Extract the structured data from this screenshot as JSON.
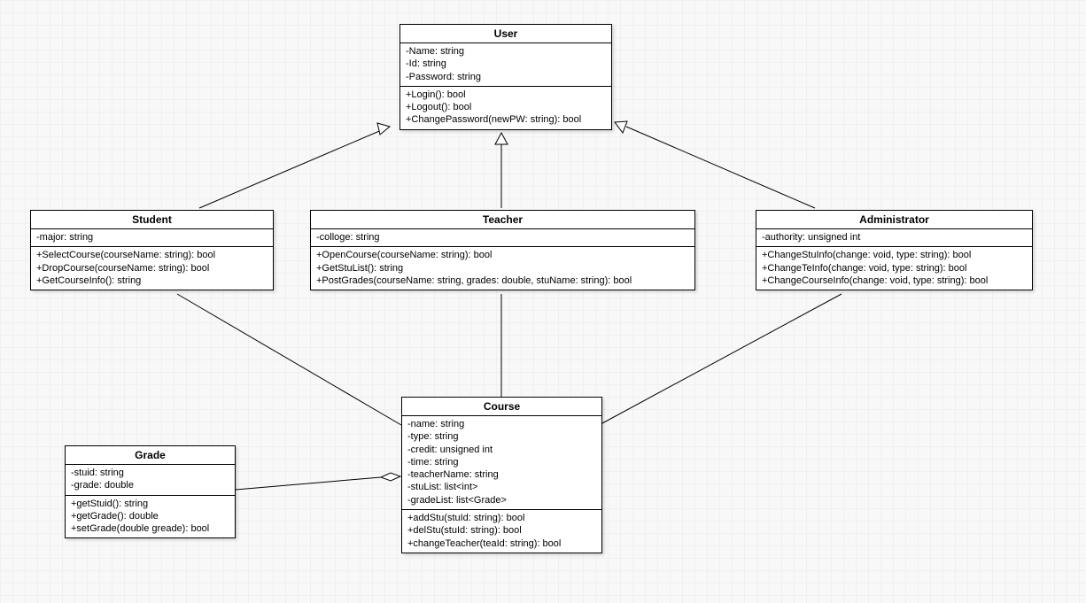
{
  "classes": {
    "user": {
      "name": "User",
      "attrs": [
        "-Name: string",
        "-Id: string",
        "-Password: string"
      ],
      "ops": [
        "+Login(): bool",
        "+Logout(): bool",
        "+ChangePassword(newPW: string): bool"
      ]
    },
    "student": {
      "name": "Student",
      "attrs": [
        "-major: string"
      ],
      "ops": [
        "+SelectCourse(courseName: string): bool",
        "+DropCourse(courseName: string): bool",
        "+GetCourseInfo(): string"
      ]
    },
    "teacher": {
      "name": "Teacher",
      "attrs": [
        "-colloge: string"
      ],
      "ops": [
        "+OpenCourse(courseName: string): bool",
        "+GetStuList(): string",
        "+PostGrades(courseName: string, grades: double, stuName: string): bool"
      ]
    },
    "administrator": {
      "name": "Administrator",
      "attrs": [
        "-authority: unsigned int"
      ],
      "ops": [
        "+ChangeStuInfo(change: void, type: string): bool",
        "+ChangeTeInfo(change: void, type: string): bool",
        "+ChangeCourseInfo(change: void, type: string): bool"
      ]
    },
    "course": {
      "name": "Course",
      "attrs": [
        "-name: string",
        "-type: string",
        "-credit: unsigned int",
        "-time: string",
        "-teacherName: string",
        "-stuList: list<int>",
        "-gradeList: list<Grade>"
      ],
      "ops": [
        "+addStu(stuId: string): bool",
        "+delStu(stuId: string): bool",
        "+changeTeacher(teaId: string): bool"
      ]
    },
    "grade": {
      "name": "Grade",
      "attrs": [
        "-stuid: string",
        "-grade: double"
      ],
      "ops": [
        "+getStuid(): string",
        "+getGrade(): double",
        "+setGrade(double greade): bool"
      ]
    }
  },
  "relations": [
    {
      "from": "student",
      "to": "user",
      "kind": "inherit"
    },
    {
      "from": "teacher",
      "to": "user",
      "kind": "inherit"
    },
    {
      "from": "administrator",
      "to": "user",
      "kind": "inherit"
    },
    {
      "from": "student",
      "to": "course",
      "kind": "assoc"
    },
    {
      "from": "teacher",
      "to": "course",
      "kind": "assoc"
    },
    {
      "from": "administrator",
      "to": "course",
      "kind": "assoc"
    },
    {
      "from": "grade",
      "to": "course",
      "kind": "aggregation"
    }
  ]
}
